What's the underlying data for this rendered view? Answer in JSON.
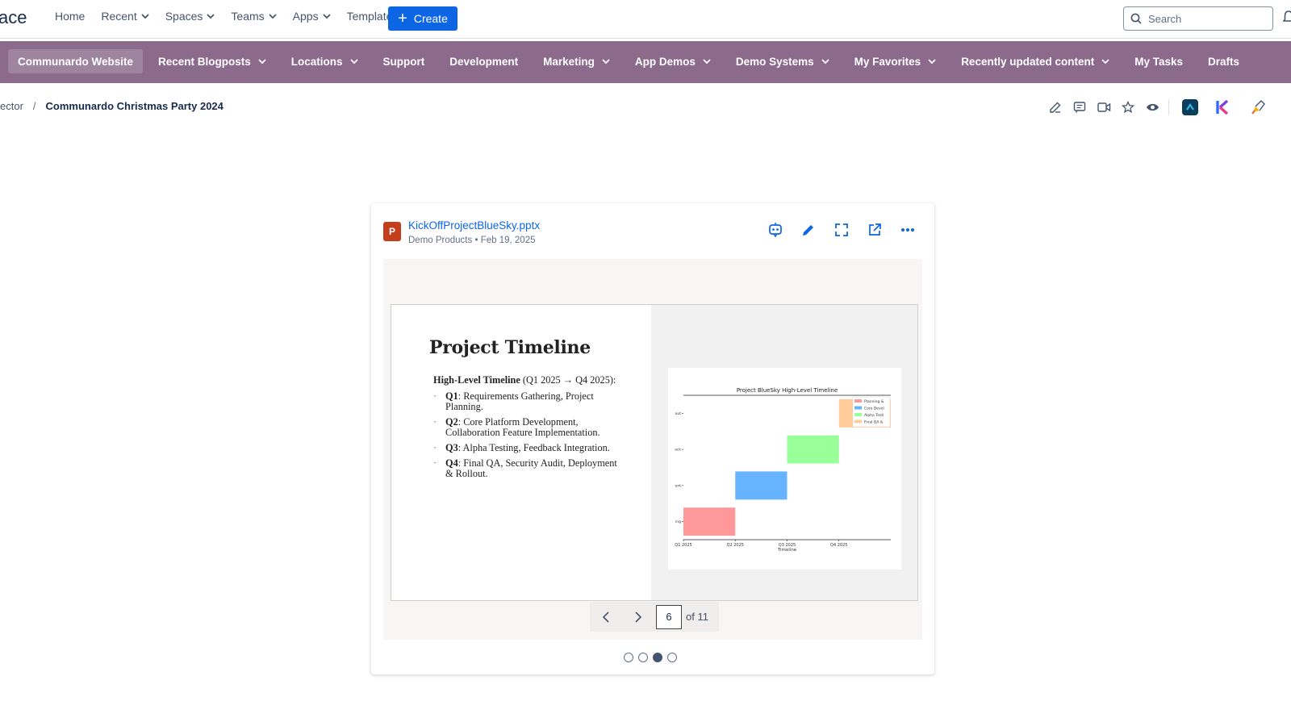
{
  "topbar": {
    "brand_fragment": "ace",
    "nav": [
      {
        "label": "Home",
        "has_menu": false
      },
      {
        "label": "Recent",
        "has_menu": true
      },
      {
        "label": "Spaces",
        "has_menu": true
      },
      {
        "label": "Teams",
        "has_menu": true
      },
      {
        "label": "Apps",
        "has_menu": true
      },
      {
        "label": "Templates",
        "has_menu": false
      }
    ],
    "create_label": "Create",
    "search_placeholder": "Search"
  },
  "spacebar": {
    "color": "#8c6a8c",
    "items": [
      {
        "label": "Communardo Website",
        "has_menu": false,
        "active": true
      },
      {
        "label": "Recent Blogposts",
        "has_menu": true
      },
      {
        "label": "Locations",
        "has_menu": true
      },
      {
        "label": "Support",
        "has_menu": false
      },
      {
        "label": "Development",
        "has_menu": false
      },
      {
        "label": "Marketing",
        "has_menu": true
      },
      {
        "label": "App Demos",
        "has_menu": true
      },
      {
        "label": "Demo Systems",
        "has_menu": true
      },
      {
        "label": "My Favorites",
        "has_menu": true
      },
      {
        "label": "Recently updated content",
        "has_menu": true
      },
      {
        "label": "My Tasks",
        "has_menu": false
      },
      {
        "label": "Drafts",
        "has_menu": false
      }
    ]
  },
  "breadcrumb": {
    "previous": "ector",
    "separator": "/",
    "current": "Communardo Christmas Party 2024"
  },
  "card": {
    "file_name": "KickOffProjectBlueSky.pptx",
    "file_type_letter": "P",
    "space": "Demo Products",
    "meta_separator": "•",
    "date": "Feb 19, 2025",
    "accent_color": "#0c66e4"
  },
  "slide": {
    "title": "Project Timeline",
    "intro_bold": "High-Level Timeline",
    "intro_rest": " (Q1 2025 → Q4 2025):",
    "bullets": [
      {
        "q": "Q1",
        "text": ": Requirements Gathering, Project Planning."
      },
      {
        "q": "Q2",
        "text": ": Core Platform Development, Collaboration Feature Implementation."
      },
      {
        "q": "Q3",
        "text": ": Alpha Testing, Feedback Integration."
      },
      {
        "q": "Q4",
        "text": ": Final QA, Security Audit, Deployment & Rollout."
      }
    ]
  },
  "chart_data": {
    "type": "bar",
    "title": "Project BlueSky High-Level Timeline",
    "xlabel": "Timeline",
    "ylabel": "",
    "x_ticks": [
      "Q1 2025",
      "Q2 2025",
      "Q3 2025",
      "Q4 2025"
    ],
    "y_ticks": [
      "ing",
      "ent",
      "ack",
      "out"
    ],
    "legend_position": "top-right",
    "series": [
      {
        "name": "Planning &",
        "start": 0,
        "end": 1,
        "row": 0,
        "color": "#ff9999"
      },
      {
        "name": "Core Devel",
        "start": 1,
        "end": 2,
        "row": 1,
        "color": "#66b3ff"
      },
      {
        "name": "Alpha Testi",
        "start": 2,
        "end": 3,
        "row": 2,
        "color": "#99ff99"
      },
      {
        "name": "Final QA &",
        "start": 3,
        "end": 4,
        "row": 3,
        "color": "#ffcc99"
      }
    ]
  },
  "pager": {
    "current_page": "6",
    "of_label": "of 11"
  },
  "carousel": {
    "count": 4,
    "active_index": 2
  }
}
